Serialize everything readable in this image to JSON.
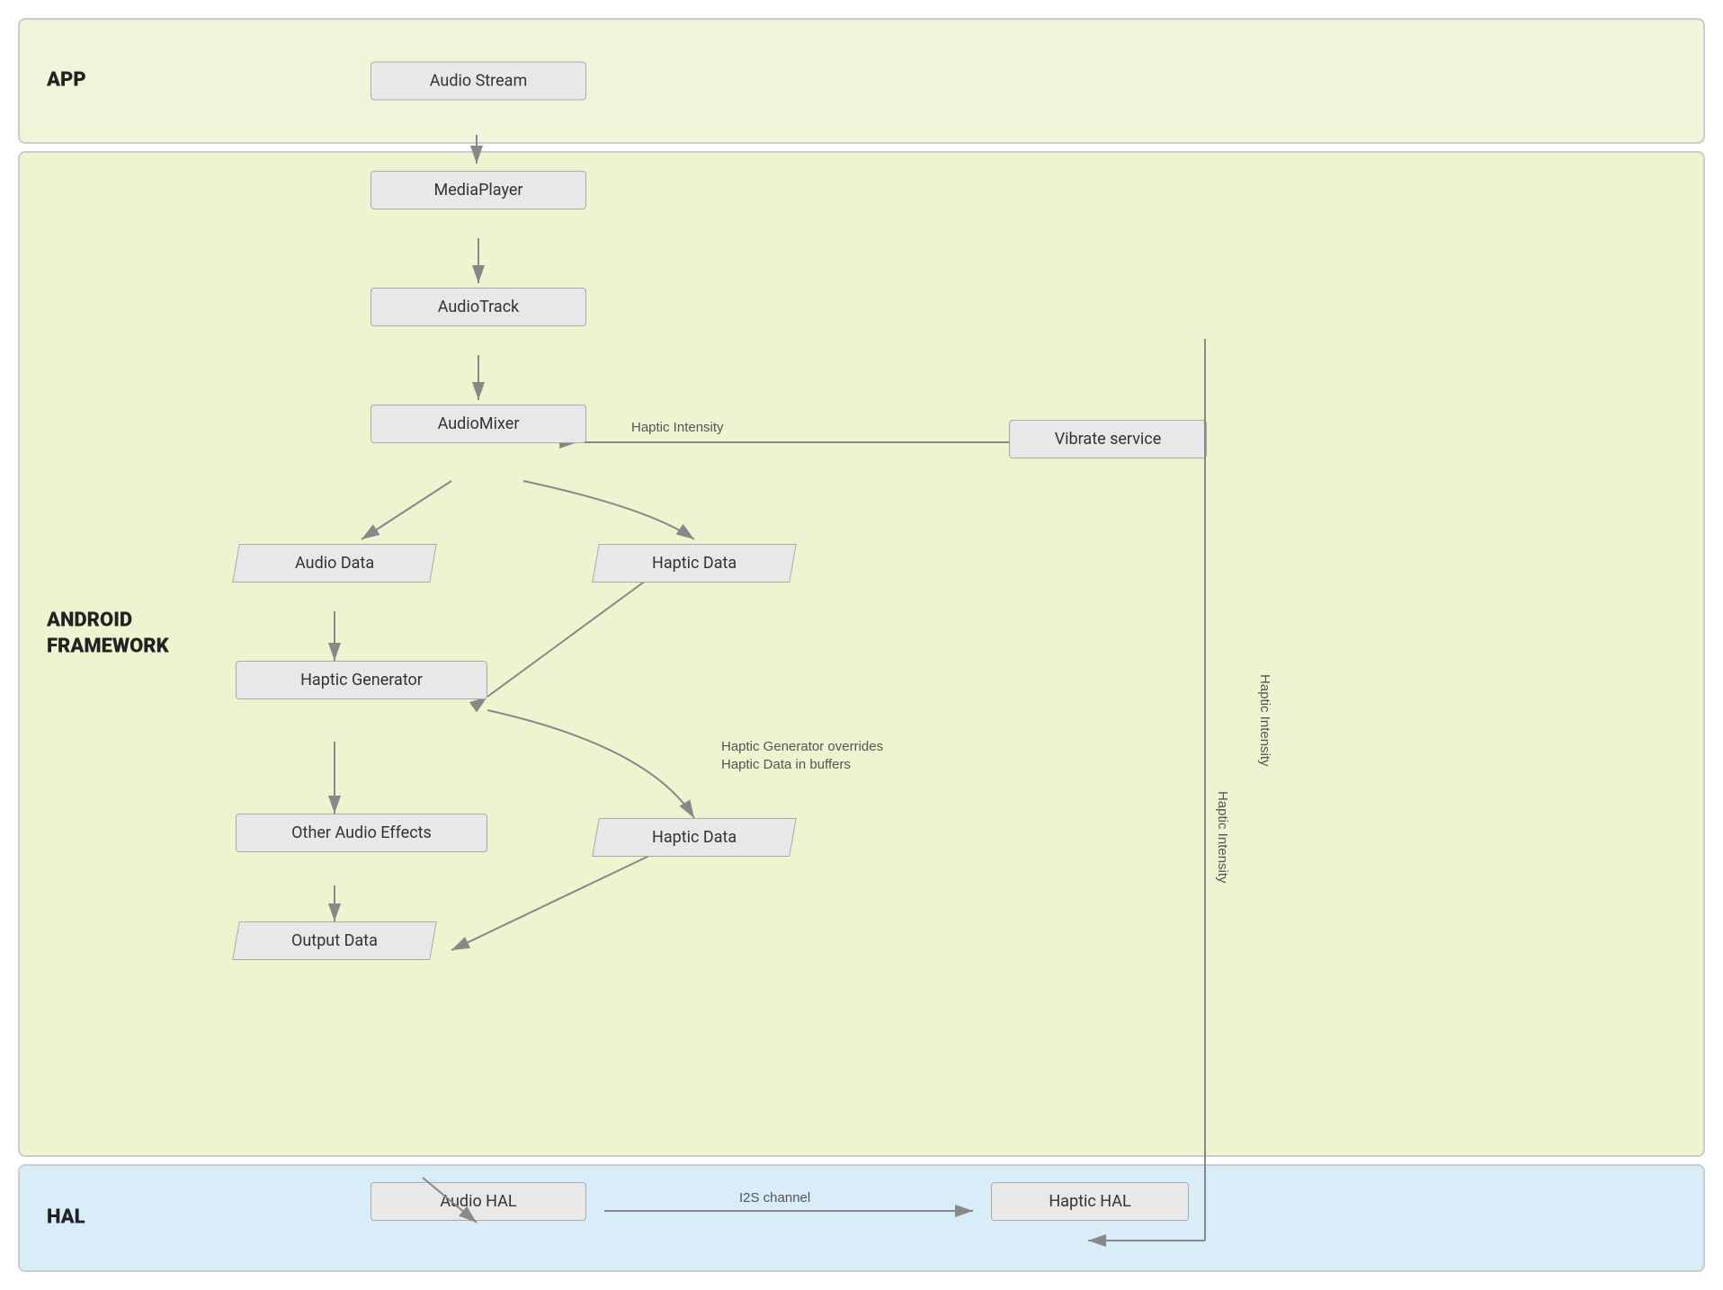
{
  "sections": {
    "app": {
      "label": "APP",
      "nodes": {
        "audio_stream": "Audio Stream"
      }
    },
    "framework": {
      "label": "ANDROID\nFRAMEWORK",
      "nodes": {
        "media_player": "MediaPlayer",
        "audio_track": "AudioTrack",
        "audio_mixer": "AudioMixer",
        "vibrate_service": "Vibrate service",
        "audio_data": "Audio Data",
        "haptic_data_top": "Haptic Data",
        "haptic_generator": "Haptic Generator",
        "other_audio_effects": "Other Audio Effects",
        "haptic_data_bottom": "Haptic Data",
        "output_data": "Output Data"
      },
      "labels": {
        "haptic_intensity_top": "Haptic Intensity",
        "haptic_intensity_right": "Haptic Intensity",
        "haptic_generator_overrides": "Haptic Generator overrides\nHaptic Data in buffers"
      }
    },
    "hal": {
      "label": "HAL",
      "nodes": {
        "audio_hal": "Audio HAL",
        "haptic_hal": "Haptic HAL",
        "i2s_channel": "I2S channel"
      }
    }
  }
}
